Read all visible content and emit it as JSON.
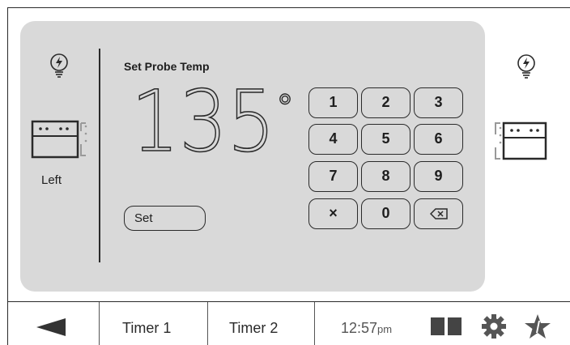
{
  "screen": {
    "title": "Set Probe Temp",
    "temperature": "135",
    "degree_symbol": "°",
    "set_label": "Set"
  },
  "left_oven": {
    "label": "Left"
  },
  "keypad": [
    "1",
    "2",
    "3",
    "4",
    "5",
    "6",
    "7",
    "8",
    "9",
    "×",
    "0"
  ],
  "bottom_bar": {
    "timer1": "Timer 1",
    "timer2": "Timer 2",
    "time": "12:57",
    "time_suffix": "pm"
  },
  "icons": {
    "left_bulb": "light-bulb-icon",
    "right_bulb": "light-bulb-icon",
    "left_oven": "oven-icon",
    "right_oven": "oven-icon",
    "back": "back-arrow-icon",
    "split": "split-view-icon",
    "settings": "gear-icon",
    "favorites": "star-icon",
    "backspace": "backspace-icon"
  },
  "colors": {
    "panel": "#d9d9d9",
    "ink": "#2a2a2a"
  }
}
